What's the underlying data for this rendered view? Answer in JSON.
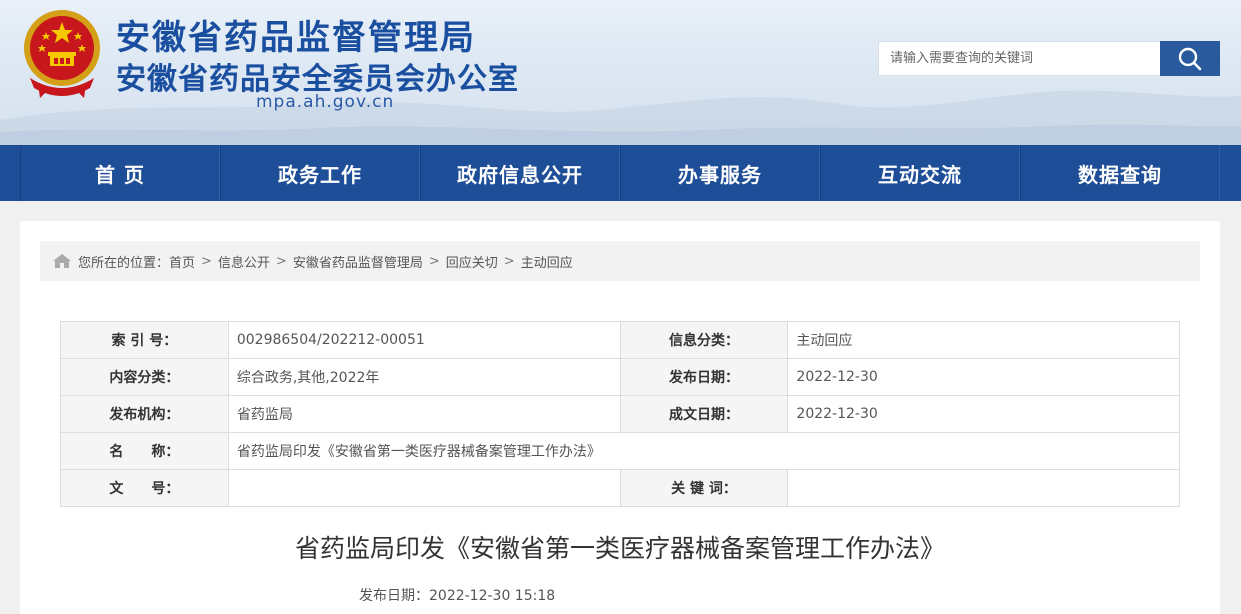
{
  "header": {
    "title_line1": "安徽省药品监督管理局",
    "title_line2": "安徽省药品安全委员会办公室",
    "domain": "mpa.ah.gov.cn",
    "search_placeholder": "请输入需要查询的关键词"
  },
  "nav": {
    "items": [
      "首 页",
      "政务工作",
      "政府信息公开",
      "办事服务",
      "互动交流",
      "数据查询"
    ]
  },
  "breadcrumb": {
    "prefix": "您所在的位置：",
    "items": [
      "首页",
      "信息公开",
      "安徽省药品监督管理局",
      "回应关切",
      "主动回应"
    ],
    "separator": ">"
  },
  "meta": {
    "index_label": "索 引 号：",
    "index_value": "002986504/202212-00051",
    "info_category_label": "信息分类：",
    "info_category_value": "主动回应",
    "content_category_label": "内容分类：",
    "content_category_value": "综合政务,其他,2022年",
    "publish_date_label": "发布日期：",
    "publish_date_value": "2022-12-30",
    "publisher_label": "发布机构：",
    "publisher_value": "省药监局",
    "written_date_label": "成文日期：",
    "written_date_value": "2022-12-30",
    "name_label": "名　　称：",
    "name_value": "省药监局印发《安徽省第一类医疗器械备案管理工作办法》",
    "doc_no_label": "文　　号：",
    "doc_no_value": "",
    "keywords_label": "关 键 词：",
    "keywords_value": ""
  },
  "article": {
    "title": "省药监局印发《安徽省第一类医疗器械备案管理工作办法》",
    "pubdate": "发布日期：2022-12-30 15:18"
  },
  "colors": {
    "brand_blue": "#1f4e98",
    "title_blue": "#1a4fa0",
    "search_btn": "#2a5a9e"
  }
}
